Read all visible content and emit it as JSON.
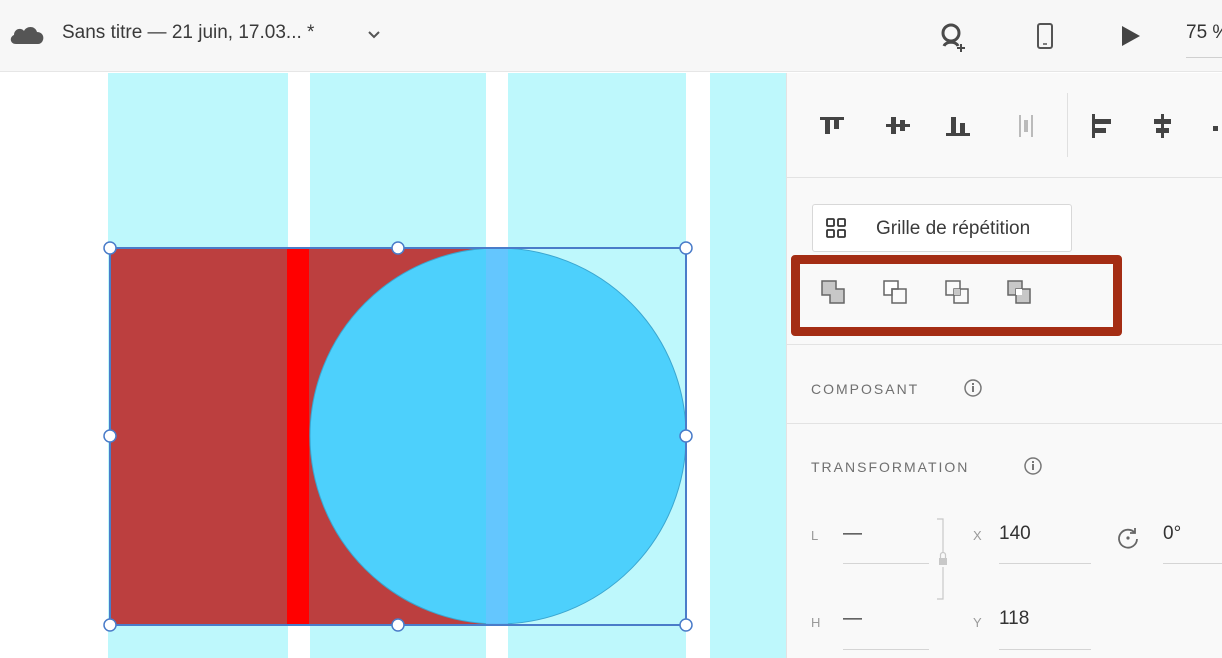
{
  "topbar": {
    "document_title": "Sans titre — 21 juin, 17.03... *",
    "zoom": "75 %",
    "icons": [
      "cloud-icon",
      "chevron-down-icon",
      "share-user-icon",
      "device-preview-icon",
      "play-icon"
    ]
  },
  "canvas": {
    "column_color": "#bef8fc",
    "rectangle_color": "#bc3f3f",
    "red_strip_color": "#ff0000",
    "circle_color": "#4dd0fc",
    "selection_color": "#4a7cc9"
  },
  "panel": {
    "align_icons": [
      "align-top-icon",
      "align-middle-vertical-icon",
      "align-bottom-icon",
      "distribute-vertical-icon",
      "align-left-icon",
      "align-center-horizontal-icon"
    ],
    "repeat_grid_label": "Grille de répétition",
    "boolean_icons": [
      "add-union-icon",
      "subtract-icon",
      "intersect-icon",
      "exclude-overlap-icon"
    ],
    "highlight_color": "#a42d14",
    "component_section": "COMPOSANT",
    "transform_section": "TRANSFORMATION",
    "transform": {
      "width_label": "L",
      "width_value": "—",
      "height_label": "H",
      "height_value": "—",
      "x_label": "X",
      "x_value": "140",
      "y_label": "Y",
      "y_value": "118",
      "rotation_value": "0°"
    }
  }
}
